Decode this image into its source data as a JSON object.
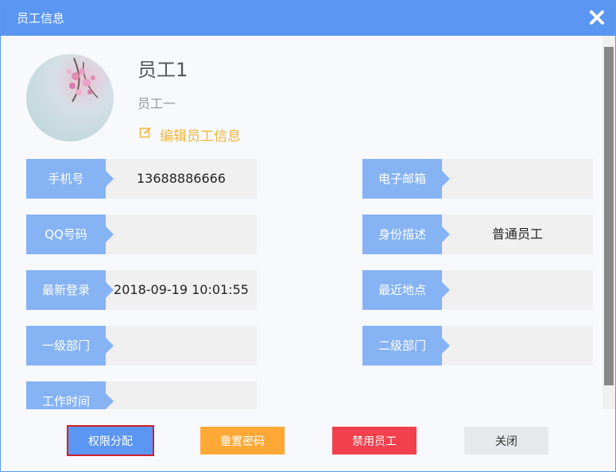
{
  "window": {
    "title": "员工信息"
  },
  "profile": {
    "name": "员工1",
    "subtitle": "员工一",
    "edit_link": "编辑员工信息"
  },
  "fields": {
    "phone": {
      "label": "手机号",
      "value": "13688886666"
    },
    "email": {
      "label": "电子邮箱",
      "value": ""
    },
    "qq": {
      "label": "QQ号码",
      "value": ""
    },
    "role": {
      "label": "身份描述",
      "value": "普通员工"
    },
    "last_login": {
      "label": "最新登录",
      "value": "2018-09-19 10:01:55"
    },
    "last_location": {
      "label": "最近地点",
      "value": ""
    },
    "dept1": {
      "label": "一级部门",
      "value": ""
    },
    "dept2": {
      "label": "二级部门",
      "value": ""
    },
    "work_time": {
      "label": "工作时间",
      "value": ""
    }
  },
  "buttons": {
    "permissions": "权限分配",
    "reset_password": "重置密码",
    "disable": "禁用员工",
    "close": "关闭"
  },
  "colors": {
    "titlebar": "#5b96f3",
    "label_bg": "#86b3f4",
    "edit_link": "#f2b53a",
    "reset_button": "#ffa836",
    "disable_button": "#f2404c"
  },
  "icons": [
    "close-icon",
    "edit-icon"
  ]
}
